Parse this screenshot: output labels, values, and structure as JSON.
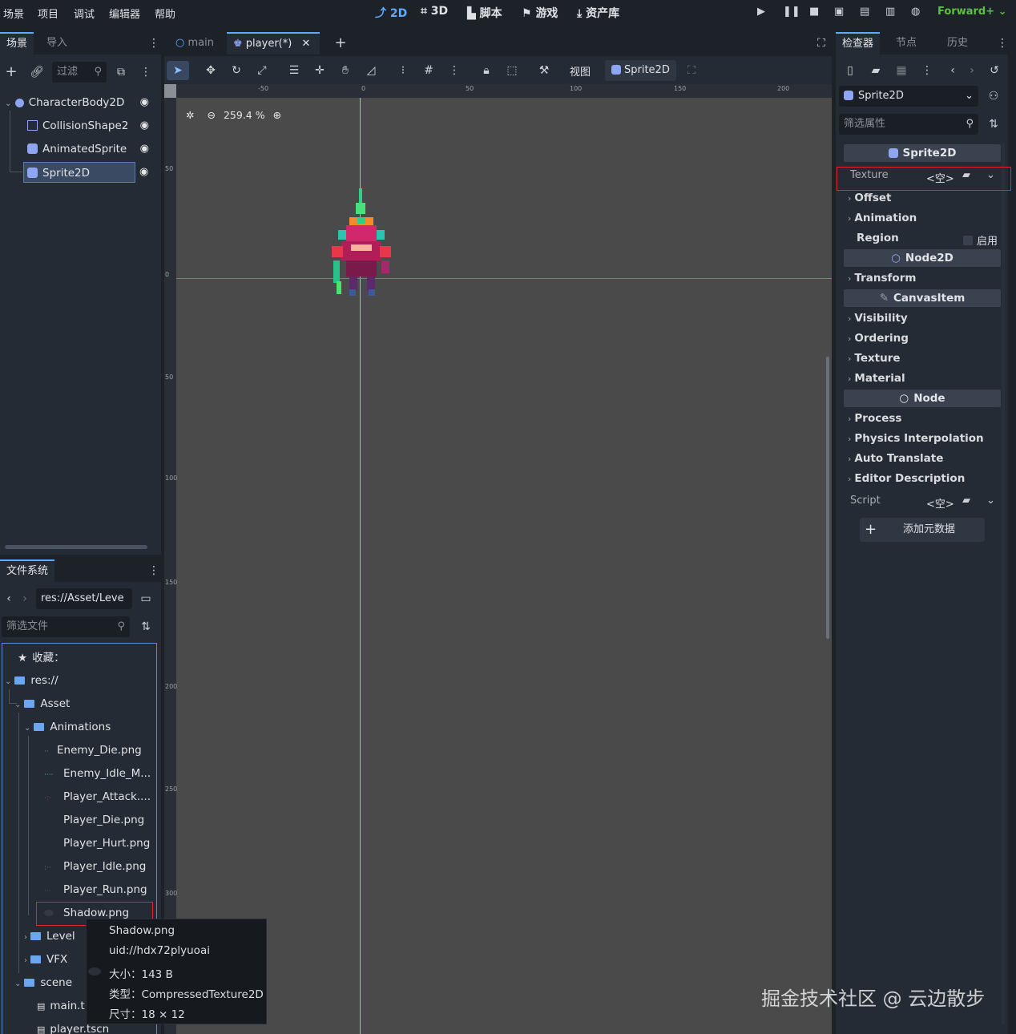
{
  "menu": [
    "场景",
    "项目",
    "调试",
    "编辑器",
    "帮助"
  ],
  "workspaces": [
    {
      "label": "2D",
      "icon": "2d-icon",
      "active": true
    },
    {
      "label": "3D",
      "icon": "3d-icon",
      "active": false
    },
    {
      "label": "脚本",
      "icon": "script-icon",
      "active": false
    },
    {
      "label": "游戏",
      "icon": "game-icon",
      "active": false
    },
    {
      "label": "资产库",
      "icon": "asset-library-icon",
      "active": false
    }
  ],
  "renderer": "Forward+",
  "scene_dock": {
    "tabs": [
      "场景",
      "导入"
    ],
    "filter_placeholder": "过滤",
    "nodes": [
      {
        "label": "CharacterBody2D",
        "icon": "character-body-icon"
      },
      {
        "label": "CollisionShape2",
        "icon": "collision-shape-icon"
      },
      {
        "label": "AnimatedSprite",
        "icon": "animated-sprite-icon"
      },
      {
        "label": "Sprite2D",
        "icon": "sprite-icon",
        "selected": true
      }
    ]
  },
  "editor_tabs": [
    {
      "label": "main",
      "active": false
    },
    {
      "label": "player(*)",
      "active": true
    }
  ],
  "toolbar": {
    "view_label": "视图",
    "node_label": "Sprite2D"
  },
  "viewport": {
    "zoom": "259.4 %",
    "ruler_h": [
      "-50",
      "0",
      "50",
      "100",
      "150",
      "200"
    ],
    "ruler_v": [
      "50",
      "0",
      "50",
      "100",
      "150",
      "200",
      "250",
      "300"
    ]
  },
  "filesystem": {
    "tab": "文件系统",
    "path": "res://Asset/Leve",
    "filter_placeholder": "筛选文件",
    "items": [
      {
        "label": "收藏：",
        "kind": "favorites"
      },
      {
        "label": "res://",
        "kind": "folder"
      },
      {
        "label": "Asset",
        "kind": "folder"
      },
      {
        "label": "Animations",
        "kind": "folder"
      },
      {
        "label": "Enemy_Die.png",
        "kind": "file"
      },
      {
        "label": "Enemy_Idle_M...",
        "kind": "file"
      },
      {
        "label": "Player_Attack....",
        "kind": "file"
      },
      {
        "label": "Player_Die.png",
        "kind": "file"
      },
      {
        "label": "Player_Hurt.png",
        "kind": "file"
      },
      {
        "label": "Player_Idle.png",
        "kind": "file"
      },
      {
        "label": "Player_Run.png",
        "kind": "file"
      },
      {
        "label": "Shadow.png",
        "kind": "file"
      },
      {
        "label": "Level",
        "kind": "folder"
      },
      {
        "label": "VFX",
        "kind": "folder"
      },
      {
        "label": "scene",
        "kind": "folder"
      },
      {
        "label": "main.t",
        "kind": "scene-file"
      },
      {
        "label": "player.tscn",
        "kind": "scene-file"
      }
    ]
  },
  "tooltip": {
    "name": "Shadow.png",
    "uid": "uid://hdx72plyuoai",
    "size": "大小：143 B",
    "type": "类型：CompressedTexture2D",
    "dims": "尺寸：18 × 12"
  },
  "inspector": {
    "tabs": [
      "检查器",
      "节点",
      "历史"
    ],
    "node_select": "Sprite2D",
    "filter_placeholder": "筛选属性",
    "sprite_header": "Sprite2D",
    "texture_label": "Texture",
    "texture_value": "<空>",
    "props_sprite": [
      "Offset",
      "Animation"
    ],
    "region_label": "Region",
    "region_toggle": "启用",
    "node2d_header": "Node2D",
    "props_node2d": [
      "Transform"
    ],
    "canvasitem_header": "CanvasItem",
    "props_canvas": [
      "Visibility",
      "Ordering",
      "Texture",
      "Material"
    ],
    "node_header": "Node",
    "props_node": [
      "Process",
      "Physics Interpolation",
      "Auto Translate",
      "Editor Description"
    ],
    "script_label": "Script",
    "script_value": "<空>",
    "add_meta": "添加元数据"
  },
  "watermark": "掘金技术社区 @ 云边散步",
  "colors": {
    "accent": "#5fa9ff",
    "highlight_box": "#e0262b",
    "renderer": "#5fbf3f"
  }
}
